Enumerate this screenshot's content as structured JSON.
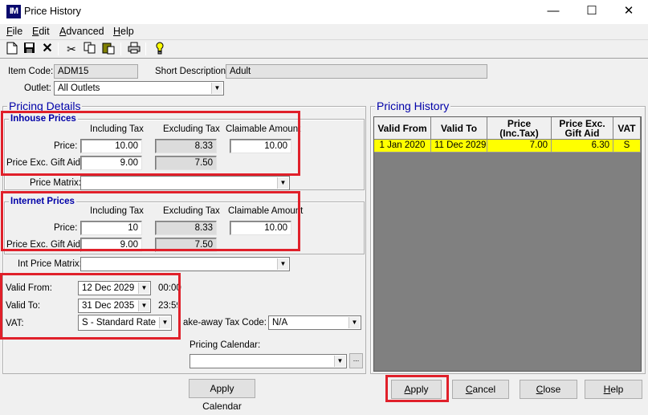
{
  "window": {
    "title": "Price History",
    "icon_text": "IM",
    "minimize": "—",
    "maximize": "☐",
    "close": "✕"
  },
  "menu": [
    {
      "first": "F",
      "rest": "ile"
    },
    {
      "first": "E",
      "rest": "dit"
    },
    {
      "first": "A",
      "rest": "dvanced"
    },
    {
      "first": "H",
      "rest": "elp"
    }
  ],
  "toolbar": {
    "icons": [
      "new-icon",
      "save-icon",
      "delete-icon",
      "cut-icon",
      "copy-icon",
      "paste-icon",
      "print-icon",
      "hint-icon"
    ]
  },
  "header": {
    "item_code_label": "Item Code:",
    "item_code": "ADM15",
    "short_desc_label": "Short Description:",
    "short_desc": "Adult",
    "outlet_label": "Outlet:",
    "outlet": "All Outlets"
  },
  "pricing_details": {
    "title": "Pricing Details",
    "inhouse": {
      "title": "Inhouse Prices",
      "col_incl": "Including Tax",
      "col_excl": "Excluding Tax",
      "col_claim": "Claimable Amount",
      "price_label": "Price:",
      "price_incl": "10.00",
      "price_excl": "8.33",
      "price_claim": "10.00",
      "gift_label": "Price Exc. Gift Aid:",
      "gift_incl": "9.00",
      "gift_excl": "7.50",
      "matrix_label": "Price Matrix:",
      "matrix": ""
    },
    "internet": {
      "title": "Internet Prices",
      "col_incl": "Including Tax",
      "col_excl": "Excluding Tax",
      "col_claim": "Claimable Amount",
      "price_label": "Price:",
      "price_incl": "10",
      "price_excl": "8.33",
      "price_claim": "10.00",
      "gift_label": "Price Exc. Gift Aid:",
      "gift_incl": "9.00",
      "gift_excl": "7.50",
      "matrix_label": "Int Price Matrix:",
      "matrix": ""
    },
    "valid_from_label": "Valid From:",
    "valid_from": "12 Dec 2029",
    "valid_from_time": "00:00",
    "valid_to_label": "Valid To:",
    "valid_to": "31 Dec 2035",
    "valid_to_time": "23:59",
    "vat_label": "VAT:",
    "vat": "S - Standard Rate",
    "takeaway_label": "ake-away Tax Code:",
    "takeaway": "N/A",
    "calendar_label": "Pricing Calendar:",
    "calendar": "",
    "calendar_btn": "..."
  },
  "pricing_history": {
    "title": "Pricing History",
    "columns": [
      "Valid From",
      "Valid To",
      "Price (Inc.Tax)",
      "Price Exc. Gift Aid",
      "VAT"
    ],
    "rows": [
      [
        "1 Jan 2020",
        "11 Dec 2029",
        "7.00",
        "6.30",
        "S"
      ]
    ]
  },
  "buttons": {
    "apply_calendar": "Apply Calendar",
    "apply": {
      "first": "A",
      "rest": "pply"
    },
    "cancel": {
      "first": "C",
      "rest": "ancel"
    },
    "close": {
      "first": "C",
      "rest": "lose"
    },
    "help": {
      "first": "H",
      "rest": "elp"
    }
  },
  "colors": {
    "accent": "#0000a8",
    "highlight": "#e0202a",
    "selected_row": "#ffff00",
    "grid_bg": "#808080"
  }
}
